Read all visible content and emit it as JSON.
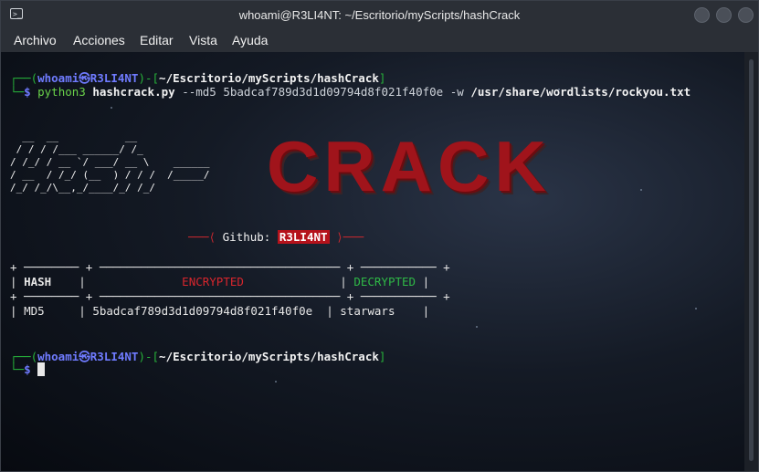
{
  "window": {
    "title": "whoami@R3LI4NT: ~/Escritorio/myScripts/hashCrack"
  },
  "menu": [
    "Archivo",
    "Acciones",
    "Editar",
    "Vista",
    "Ayuda"
  ],
  "prompt": {
    "user": "whoami",
    "at": "㉿",
    "host": "R3LI4NT",
    "path": "~/Escritorio/myScripts/hashCrack",
    "symbol": "$"
  },
  "command": {
    "interpreter": "python3",
    "script": "hashcrack.py",
    "flag1": "--md5",
    "hash": "5badcaf789d3d1d09794d8f021f40f0e",
    "flag2": "-w",
    "wordlist": "/usr/share/wordlists/rockyou.txt"
  },
  "banner": {
    "ascii_left": "  __  __           __\n / / / /___ ______/ /_\n/ /_/ / __ `/ ___/ __ \\    ______\n/ __  / /_/ (__  ) / / /  /_____/\n/_/ /_/\\__,_/____/_/ /_/",
    "crack": "CRACK",
    "credit_label": "Github:",
    "credit_handle": "R3LI4NT"
  },
  "table": {
    "headers": [
      "HASH",
      "ENCRYPTED",
      "DECRYPTED"
    ],
    "row": [
      "MD5",
      "5badcaf789d3d1d09794d8f021f40f0e",
      "starwars"
    ]
  }
}
